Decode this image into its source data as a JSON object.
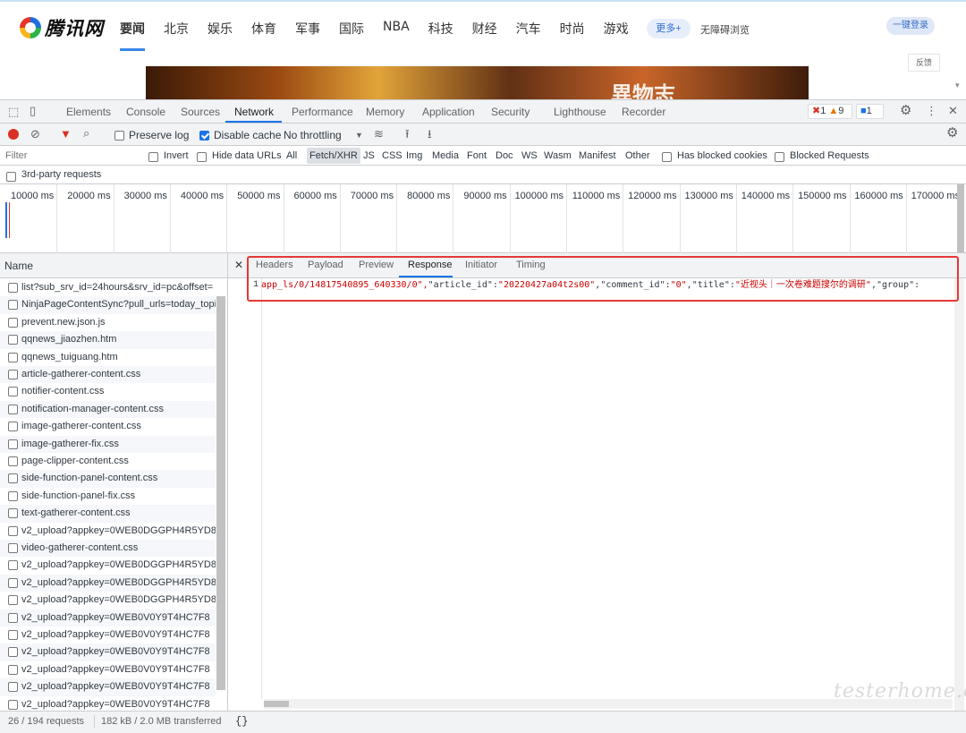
{
  "site": {
    "logo_text": "腾讯网",
    "nav": [
      "要闻",
      "北京",
      "娱乐",
      "体育",
      "军事",
      "国际",
      "NBA",
      "科技",
      "财经",
      "汽车",
      "时尚",
      "游戏"
    ],
    "more": "更多+",
    "accessibility": "无障碍浏览",
    "login": "一键登录",
    "banner_text": "異物志",
    "feedback": "反馈"
  },
  "devtools": {
    "tabs": [
      "Elements",
      "Console",
      "Sources",
      "Network",
      "Performance",
      "Memory",
      "Application",
      "Security",
      "Lighthouse",
      "Recorder"
    ],
    "active_tab": "Network",
    "badges": {
      "errors": "1",
      "warnings": "9",
      "messages": "1"
    },
    "toolbar": {
      "preserve_log": "Preserve log",
      "disable_cache": "Disable cache",
      "throttling": "No throttling"
    },
    "filter": {
      "placeholder": "Filter",
      "invert": "Invert",
      "hide_data_urls": "Hide data URLs",
      "types": [
        "All",
        "Fetch/XHR",
        "JS",
        "CSS",
        "Img",
        "Media",
        "Font",
        "Doc",
        "WS",
        "Wasm",
        "Manifest",
        "Other"
      ],
      "active_type": "Fetch/XHR",
      "blocked_cookies": "Has blocked cookies",
      "blocked_requests": "Blocked Requests",
      "third_party": "3rd-party requests"
    },
    "timeline_ticks": [
      "10000 ms",
      "20000 ms",
      "30000 ms",
      "40000 ms",
      "50000 ms",
      "60000 ms",
      "70000 ms",
      "80000 ms",
      "90000 ms",
      "100000 ms",
      "110000 ms",
      "120000 ms",
      "130000 ms",
      "140000 ms",
      "150000 ms",
      "160000 ms",
      "170000 ms"
    ],
    "name_header": "Name",
    "requests": [
      "list?sub_srv_id=24hours&srv_id=pc&offset=",
      "NinjaPageContentSync?pull_urls=today_topi",
      "prevent.new.json.js",
      "qqnews_jiaozhen.htm",
      "qqnews_tuiguang.htm",
      "article-gatherer-content.css",
      "notifier-content.css",
      "notification-manager-content.css",
      "image-gatherer-content.css",
      "image-gatherer-fix.css",
      "page-clipper-content.css",
      "side-function-panel-content.css",
      "side-function-panel-fix.css",
      "text-gatherer-content.css",
      "v2_upload?appkey=0WEB0DGGPH4R5YD8",
      "video-gatherer-content.css",
      "v2_upload?appkey=0WEB0DGGPH4R5YD8",
      "v2_upload?appkey=0WEB0DGGPH4R5YD8",
      "v2_upload?appkey=0WEB0DGGPH4R5YD8",
      "v2_upload?appkey=0WEB0V0Y9T4HC7F8",
      "v2_upload?appkey=0WEB0V0Y9T4HC7F8",
      "v2_upload?appkey=0WEB0V0Y9T4HC7F8",
      "v2_upload?appkey=0WEB0V0Y9T4HC7F8",
      "v2_upload?appkey=0WEB0V0Y9T4HC7F8",
      "v2_upload?appkey=0WEB0V0Y9T4HC7F8"
    ],
    "detail_tabs": [
      "Headers",
      "Payload",
      "Preview",
      "Response",
      "Initiator",
      "Timing"
    ],
    "active_detail_tab": "Response",
    "response": {
      "line_number": "1",
      "seg1": "app_ls/0/14817540895_640330/0\",",
      "k1": "\"article_id\"",
      "v1": "\"20220427a04t2s00\"",
      "k2": "\"comment_id\"",
      "v2": "\"0\"",
      "k3": "\"title\"",
      "v3": "\"近视头｜一次卷难题搜尔的调研\"",
      "k4": "\"group\""
    },
    "status": {
      "requests": "26 / 194 requests",
      "transferred": "182 kB / 2.0 MB transferred",
      "format": "{}"
    }
  },
  "watermark": "testerhome.com"
}
